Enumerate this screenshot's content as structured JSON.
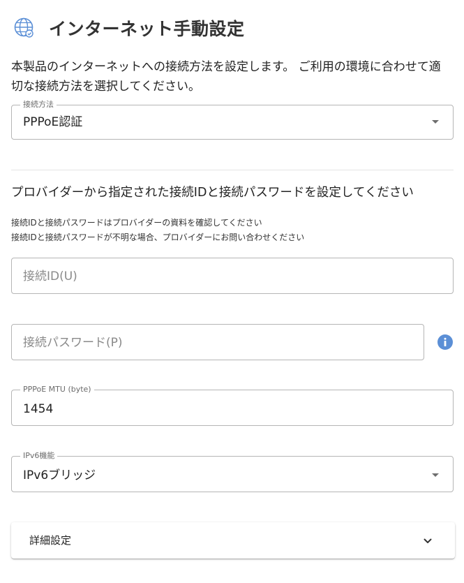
{
  "header": {
    "title": "インターネット手動設定",
    "icon": "globe-settings-icon"
  },
  "description": "本製品のインターネットへの接続方法を設定します。 ご利用の環境に合わせて適切な接続方法を選択してください。",
  "connection_method": {
    "label": "接続方法",
    "value": "PPPoE認証"
  },
  "pppoe": {
    "heading": "プロバイダーから指定された接続IDと接続パスワードを設定してください",
    "notes": [
      "接続IDと接続パスワードはプロバイダーの資料を確認してください",
      "接続IDと接続パスワードが不明な場合、プロバイダーにお問い合わせください"
    ],
    "id_placeholder": "接続ID(U)",
    "password_placeholder": "接続パスワード(P)",
    "mtu_label": "PPPoE MTU (byte)",
    "mtu_value": "1454"
  },
  "ipv6": {
    "label": "IPv6機能",
    "value": "IPv6ブリッジ"
  },
  "details": {
    "label": "詳細設定"
  },
  "colors": {
    "accent": "#5b8fd6",
    "border": "#b5b5b5",
    "text": "#222222"
  }
}
